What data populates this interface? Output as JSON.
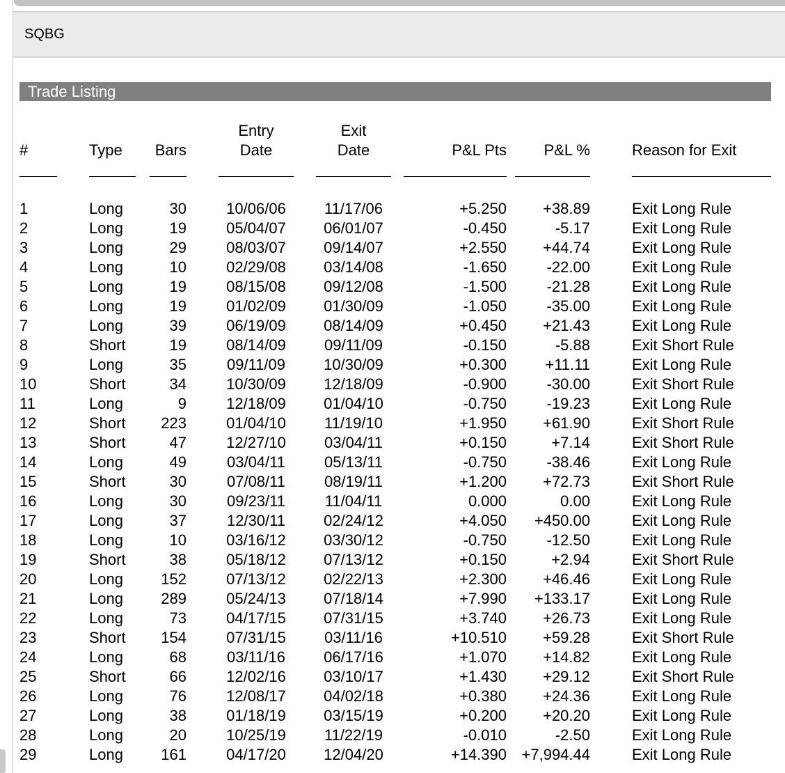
{
  "symbol": "SQBG",
  "section_title": "Trade Listing",
  "columns": {
    "num": "#",
    "type": "Type",
    "bars": "Bars",
    "entry_top": "Entry",
    "entry_bottom": "Date",
    "exit_top": "Exit",
    "exit_bottom": "Date",
    "pl_pts": "P&L Pts",
    "pl_pct": "P&L %",
    "reason": "Reason for Exit"
  },
  "trades": [
    [
      "1",
      "Long",
      "30",
      "10/06/06",
      "11/17/06",
      "+5.250",
      "+38.89",
      "Exit Long Rule"
    ],
    [
      "2",
      "Long",
      "19",
      "05/04/07",
      "06/01/07",
      "-0.450",
      "-5.17",
      "Exit Long Rule"
    ],
    [
      "3",
      "Long",
      "29",
      "08/03/07",
      "09/14/07",
      "+2.550",
      "+44.74",
      "Exit Long Rule"
    ],
    [
      "4",
      "Long",
      "10",
      "02/29/08",
      "03/14/08",
      "-1.650",
      "-22.00",
      "Exit Long Rule"
    ],
    [
      "5",
      "Long",
      "19",
      "08/15/08",
      "09/12/08",
      "-1.500",
      "-21.28",
      "Exit Long Rule"
    ],
    [
      "6",
      "Long",
      "19",
      "01/02/09",
      "01/30/09",
      "-1.050",
      "-35.00",
      "Exit Long Rule"
    ],
    [
      "7",
      "Long",
      "39",
      "06/19/09",
      "08/14/09",
      "+0.450",
      "+21.43",
      "Exit Long Rule"
    ],
    [
      "8",
      "Short",
      "19",
      "08/14/09",
      "09/11/09",
      "-0.150",
      "-5.88",
      "Exit Short Rule"
    ],
    [
      "9",
      "Long",
      "35",
      "09/11/09",
      "10/30/09",
      "+0.300",
      "+11.11",
      "Exit Long Rule"
    ],
    [
      "10",
      "Short",
      "34",
      "10/30/09",
      "12/18/09",
      "-0.900",
      "-30.00",
      "Exit Short Rule"
    ],
    [
      "11",
      "Long",
      "9",
      "12/18/09",
      "01/04/10",
      "-0.750",
      "-19.23",
      "Exit Long Rule"
    ],
    [
      "12",
      "Short",
      "223",
      "01/04/10",
      "11/19/10",
      "+1.950",
      "+61.90",
      "Exit Short Rule"
    ],
    [
      "13",
      "Short",
      "47",
      "12/27/10",
      "03/04/11",
      "+0.150",
      "+7.14",
      "Exit Short Rule"
    ],
    [
      "14",
      "Long",
      "49",
      "03/04/11",
      "05/13/11",
      "-0.750",
      "-38.46",
      "Exit Long Rule"
    ],
    [
      "15",
      "Short",
      "30",
      "07/08/11",
      "08/19/11",
      "+1.200",
      "+72.73",
      "Exit Short Rule"
    ],
    [
      "16",
      "Long",
      "30",
      "09/23/11",
      "11/04/11",
      "0.000",
      "0.00",
      "Exit Long Rule"
    ],
    [
      "17",
      "Long",
      "37",
      "12/30/11",
      "02/24/12",
      "+4.050",
      "+450.00",
      "Exit Long Rule"
    ],
    [
      "18",
      "Long",
      "10",
      "03/16/12",
      "03/30/12",
      "-0.750",
      "-12.50",
      "Exit Long Rule"
    ],
    [
      "19",
      "Short",
      "38",
      "05/18/12",
      "07/13/12",
      "+0.150",
      "+2.94",
      "Exit Short Rule"
    ],
    [
      "20",
      "Long",
      "152",
      "07/13/12",
      "02/22/13",
      "+2.300",
      "+46.46",
      "Exit Long Rule"
    ],
    [
      "21",
      "Long",
      "289",
      "05/24/13",
      "07/18/14",
      "+7.990",
      "+133.17",
      "Exit Long Rule"
    ],
    [
      "22",
      "Long",
      "73",
      "04/17/15",
      "07/31/15",
      "+3.740",
      "+26.73",
      "Exit Long Rule"
    ],
    [
      "23",
      "Short",
      "154",
      "07/31/15",
      "03/11/16",
      "+10.510",
      "+59.28",
      "Exit Short Rule"
    ],
    [
      "24",
      "Long",
      "68",
      "03/11/16",
      "06/17/16",
      "+1.070",
      "+14.82",
      "Exit Long Rule"
    ],
    [
      "25",
      "Short",
      "66",
      "12/02/16",
      "03/10/17",
      "+1.430",
      "+29.12",
      "Exit Short Rule"
    ],
    [
      "26",
      "Long",
      "76",
      "12/08/17",
      "04/02/18",
      "+0.380",
      "+24.36",
      "Exit Long Rule"
    ],
    [
      "27",
      "Long",
      "38",
      "01/18/19",
      "03/15/19",
      "+0.200",
      "+20.20",
      "Exit Long Rule"
    ],
    [
      "28",
      "Long",
      "20",
      "10/25/19",
      "11/22/19",
      "-0.010",
      "-2.50",
      "Exit Long Rule"
    ],
    [
      "29",
      "Long",
      "161",
      "04/17/20",
      "12/04/20",
      "+14.390",
      "+7,994.44",
      "Exit Long Rule"
    ]
  ]
}
